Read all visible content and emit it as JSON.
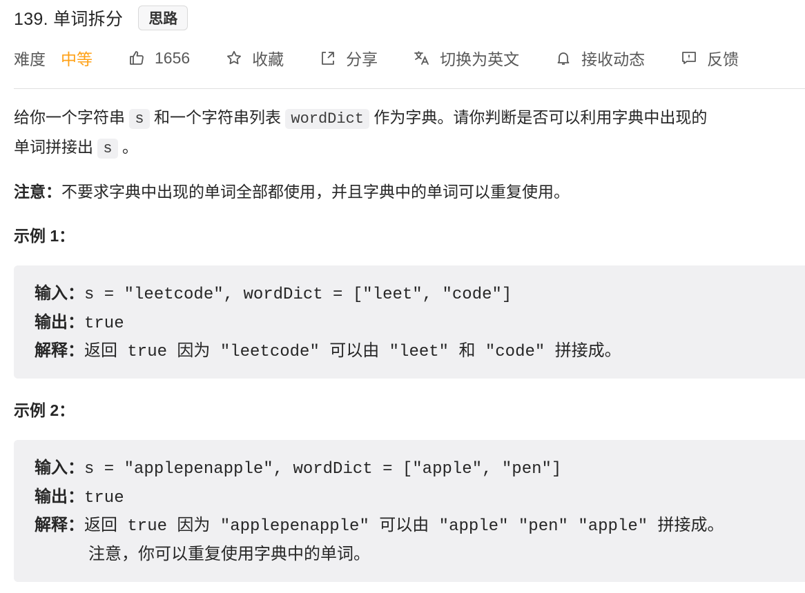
{
  "header": {
    "title": "139. 单词拆分",
    "badge": "思路"
  },
  "meta": {
    "difficulty_label": "难度",
    "difficulty_value": "中等",
    "likes": "1656",
    "favorite": "收藏",
    "share": "分享",
    "translate": "切换为英文",
    "subscribe": "接收动态",
    "feedback": "反馈"
  },
  "description": {
    "p1_a": "给你一个字符串",
    "code_s": "s",
    "p1_b": "和一个字符串列表",
    "code_wordDict": "wordDict",
    "p1_c": "作为字典。请你判断是否可以利用字典中出现的",
    "p1_d": "单词拼接出",
    "code_s2": "s",
    "p1_e": "。",
    "note_label": "注意：",
    "note_text": "不要求字典中出现的单词全部都使用，并且字典中的单词可以重复使用。"
  },
  "examples": [
    {
      "title": "示例 1：",
      "input_label": "输入：",
      "input_value": "s = \"leetcode\", wordDict = [\"leet\", \"code\"]",
      "output_label": "输出：",
      "output_value": "true",
      "explain_label": "解释：",
      "explain_parts": [
        "返回",
        " true ",
        "因为",
        " \"leetcode\" ",
        "可以由",
        " \"leet\" ",
        "和",
        " \"code\" ",
        "拼接成。"
      ]
    },
    {
      "title": "示例 2：",
      "input_label": "输入：",
      "input_value": "s = \"applepenapple\", wordDict = [\"apple\", \"pen\"]",
      "output_label": "输出：",
      "output_value": "true",
      "explain_label": "解释：",
      "explain_parts": [
        "返回",
        " true ",
        "因为",
        " \"applepenapple\" ",
        "可以由",
        " \"apple\" \"pen\" \"apple\" ",
        "拼接成。"
      ],
      "explain_line2": "注意，你可以重复使用字典中的单词。"
    }
  ]
}
